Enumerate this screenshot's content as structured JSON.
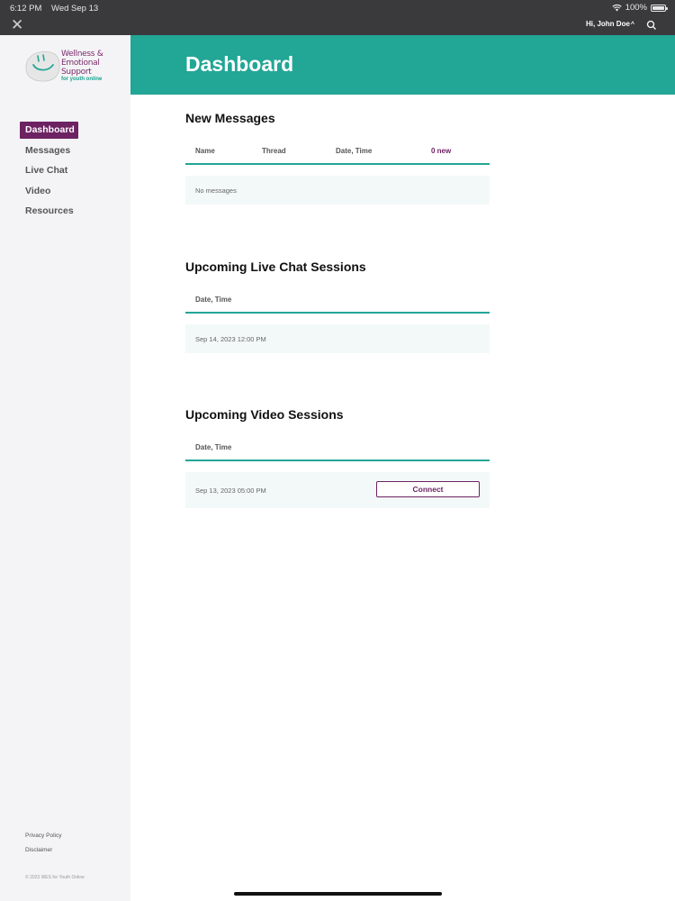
{
  "status_bar": {
    "time": "6:12 PM",
    "date": "Wed Sep 13",
    "battery": "100%",
    "battery_level": 1.0
  },
  "top_bar": {
    "user_greeting": "Hi, John Doe"
  },
  "logo": {
    "line1": "Wellness &",
    "line2": "Emotional",
    "line3": "Support",
    "tagline": "for youth online"
  },
  "sidebar": {
    "items": [
      {
        "label": "Dashboard",
        "active": true
      },
      {
        "label": "Messages",
        "active": false
      },
      {
        "label": "Live Chat",
        "active": false
      },
      {
        "label": "Video",
        "active": false
      },
      {
        "label": "Resources",
        "active": false
      }
    ],
    "footer_links": [
      "Privacy Policy",
      "Disclaimer"
    ],
    "copyright": "© 2023 WES for Youth Online"
  },
  "page": {
    "title": "Dashboard"
  },
  "new_messages": {
    "title": "New Messages",
    "columns": [
      "Name",
      "Thread",
      "Date, Time"
    ],
    "new_count": "0 new",
    "empty_text": "No messages"
  },
  "live_chat": {
    "title": "Upcoming Live Chat Sessions",
    "column": "Date, Time",
    "sessions": [
      {
        "datetime": "Sep 14, 2023 12:00 PM"
      }
    ]
  },
  "video": {
    "title": "Upcoming Video Sessions",
    "column": "Date, Time",
    "sessions": [
      {
        "datetime": "Sep 13, 2023 05:00 PM",
        "action": "Connect"
      }
    ]
  },
  "colors": {
    "teal": "#22a696",
    "purple": "#6d2262",
    "dark_bar": "#3a3a3c"
  }
}
